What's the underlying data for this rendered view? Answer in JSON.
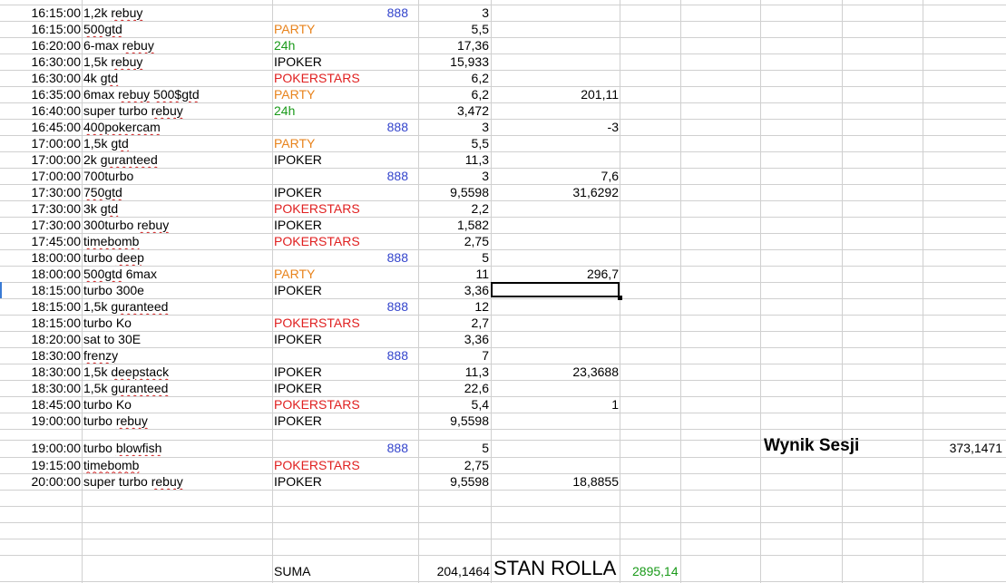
{
  "rows": [
    {
      "time": "16:15:00",
      "name": "1,2k rebuy",
      "site": "888",
      "site_color": "#3344cc",
      "buyin": "3",
      "result": ""
    },
    {
      "time": "16:15:00",
      "name": "500gtd",
      "site": "PARTY",
      "site_color": "#e8831c",
      "buyin": "5,5",
      "result": ""
    },
    {
      "time": "16:20:00",
      "name": "6-max rebuy",
      "site": "24h",
      "site_color": "#1a9a1a",
      "buyin": "17,36",
      "result": ""
    },
    {
      "time": "16:30:00",
      "name": "1,5k rebuy",
      "site": "IPOKER",
      "site_color": "#000000",
      "buyin": "15,933",
      "result": ""
    },
    {
      "time": "16:30:00",
      "name": "4k gtd",
      "site": "POKERSTARS",
      "site_color": "#e02020",
      "buyin": "6,2",
      "result": ""
    },
    {
      "time": "16:35:00",
      "name": "6max rebuy 500$gtd",
      "site": "PARTY",
      "site_color": "#e8831c",
      "buyin": "6,2",
      "result": "201,11"
    },
    {
      "time": "16:40:00",
      "name": "super turbo rebuy",
      "site": "24h",
      "site_color": "#1a9a1a",
      "buyin": "3,472",
      "result": ""
    },
    {
      "time": "16:45:00",
      "name": "400pokercam",
      "site": "888",
      "site_color": "#3344cc",
      "buyin": "3",
      "result": "-3"
    },
    {
      "time": "17:00:00",
      "name": "1,5k gtd",
      "site": "PARTY",
      "site_color": "#e8831c",
      "buyin": "5,5",
      "result": ""
    },
    {
      "time": "17:00:00",
      "name": "2k guranteed",
      "site": "IPOKER",
      "site_color": "#000000",
      "buyin": "11,3",
      "result": ""
    },
    {
      "time": "17:00:00",
      "name": "700turbo",
      "site": "888",
      "site_color": "#3344cc",
      "buyin": "3",
      "result": "7,6"
    },
    {
      "time": "17:30:00",
      "name": "750gtd",
      "site": "IPOKER",
      "site_color": "#000000",
      "buyin": "9,5598",
      "result": "31,6292"
    },
    {
      "time": "17:30:00",
      "name": "3k gtd",
      "site": "POKERSTARS",
      "site_color": "#e02020",
      "buyin": "2,2",
      "result": ""
    },
    {
      "time": "17:30:00",
      "name": "300turbo rebuy",
      "site": "IPOKER",
      "site_color": "#000000",
      "buyin": "1,582",
      "result": ""
    },
    {
      "time": "17:45:00",
      "name": "timebomb",
      "site": "POKERSTARS",
      "site_color": "#e02020",
      "buyin": "2,75",
      "result": ""
    },
    {
      "time": "18:00:00",
      "name": "turbo deep",
      "site": "888",
      "site_color": "#3344cc",
      "buyin": "5",
      "result": ""
    },
    {
      "time": "18:00:00",
      "name": "500gtd 6max",
      "site": "PARTY",
      "site_color": "#e8831c",
      "buyin": "11",
      "result": "296,7"
    },
    {
      "time": "18:15:00",
      "name": "turbo 300e",
      "site": "IPOKER",
      "site_color": "#000000",
      "buyin": "3,36",
      "result": ""
    },
    {
      "time": "18:15:00",
      "name": "1,5k guranteed",
      "site": "888",
      "site_color": "#3344cc",
      "buyin": "12",
      "result": ""
    },
    {
      "time": "18:15:00",
      "name": "turbo Ko",
      "site": "POKERSTARS",
      "site_color": "#e02020",
      "buyin": "2,7",
      "result": ""
    },
    {
      "time": "18:20:00",
      "name": "sat to 30E",
      "site": "IPOKER",
      "site_color": "#000000",
      "buyin": "3,36",
      "result": ""
    },
    {
      "time": "18:30:00",
      "name": "frenzy",
      "site": "888",
      "site_color": "#3344cc",
      "buyin": "7",
      "result": ""
    },
    {
      "time": "18:30:00",
      "name": "1,5k deepstack",
      "site": "IPOKER",
      "site_color": "#000000",
      "buyin": "11,3",
      "result": "23,3688"
    },
    {
      "time": "18:30:00",
      "name": "1,5k guranteed",
      "site": "IPOKER",
      "site_color": "#000000",
      "buyin": "22,6",
      "result": ""
    },
    {
      "time": "18:45:00",
      "name": "turbo Ko",
      "site": "POKERSTARS",
      "site_color": "#e02020",
      "buyin": "5,4",
      "result": "1"
    },
    {
      "time": "19:00:00",
      "name": "turbo rebuy",
      "site": "IPOKER",
      "site_color": "#000000",
      "buyin": "9,5598",
      "result": ""
    },
    {
      "time": "19:00:00",
      "name": "turbo blowfish",
      "site": "888",
      "site_color": "#3344cc",
      "buyin": "5",
      "result": ""
    },
    {
      "time": "19:15:00",
      "name": "timebomb",
      "site": "POKERSTARS",
      "site_color": "#e02020",
      "buyin": "2,75",
      "result": ""
    },
    {
      "time": "20:00:00",
      "name": "super turbo rebuy",
      "site": "IPOKER",
      "site_color": "#000000",
      "buyin": "9,5598",
      "result": "18,8855"
    }
  ],
  "session_label": "Wynik Sesji",
  "session_value": "373,1471",
  "suma_label": "SUMA",
  "suma_value": "204,1464",
  "stan_label": "STAN ROLLA",
  "stan_value": "2895,14",
  "stan_value_color": "#1a9a1a"
}
